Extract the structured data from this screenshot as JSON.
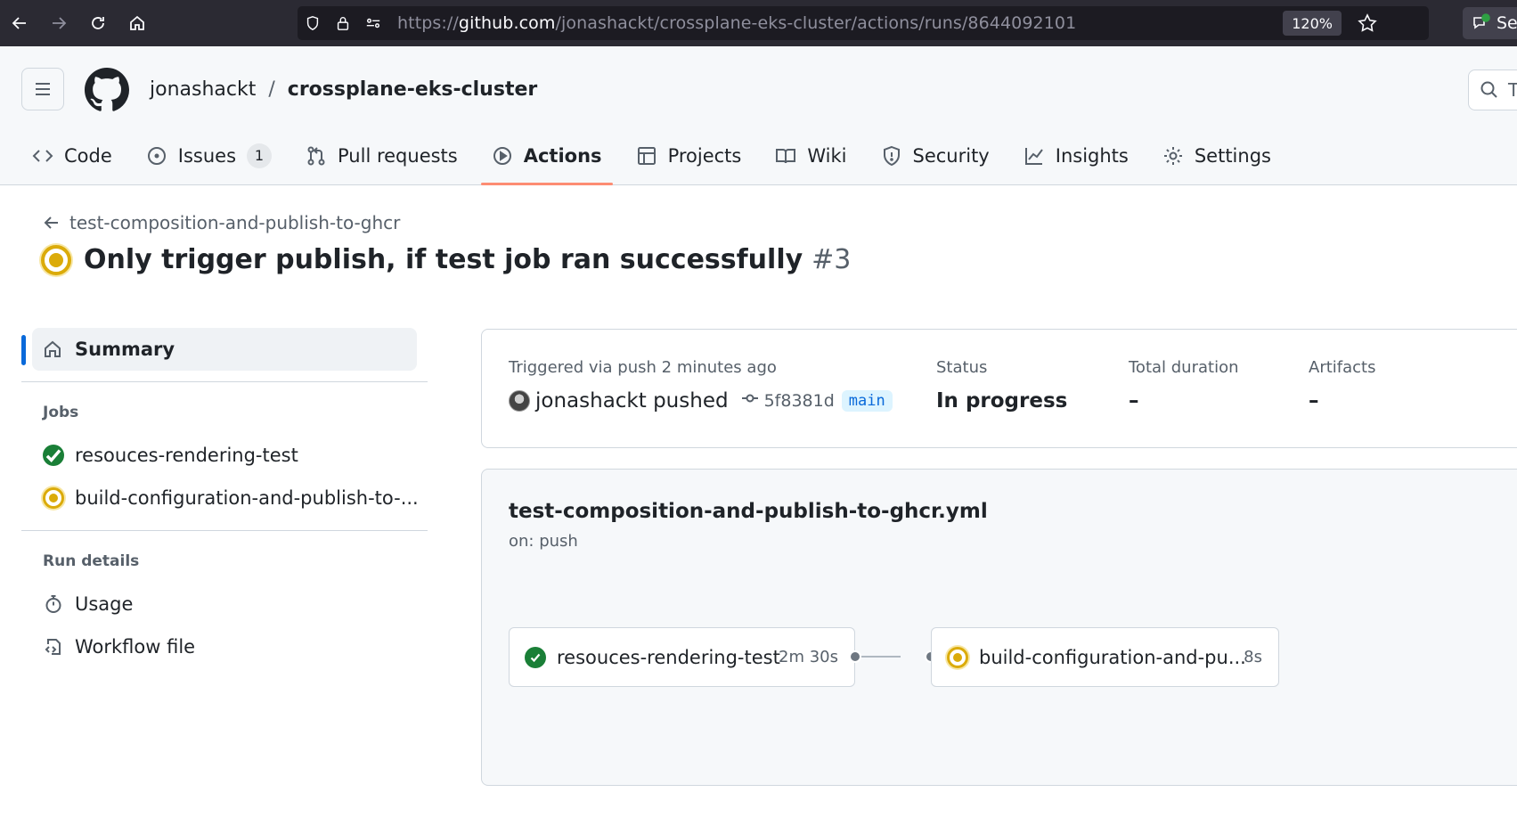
{
  "browser": {
    "url_prefix": "https://",
    "url_host": "github.com",
    "url_path": "/jonashackt/crossplane-eks-cluster/actions/runs/8644092101",
    "zoom": "120%",
    "extension_label": "Se"
  },
  "header": {
    "owner": "jonashackt",
    "separator": "/",
    "repo": "crossplane-eks-cluster",
    "search_placeholder": "T"
  },
  "tabs": [
    {
      "label": "Code"
    },
    {
      "label": "Issues",
      "count": "1"
    },
    {
      "label": "Pull requests"
    },
    {
      "label": "Actions"
    },
    {
      "label": "Projects"
    },
    {
      "label": "Wiki"
    },
    {
      "label": "Security"
    },
    {
      "label": "Insights"
    },
    {
      "label": "Settings"
    }
  ],
  "run": {
    "workflow_name": "test-composition-and-publish-to-ghcr",
    "title": "Only trigger publish, if test job ran successfully",
    "number": "#3"
  },
  "sidebar": {
    "summary_label": "Summary",
    "jobs_heading": "Jobs",
    "jobs": [
      {
        "label": "resouces-rendering-test",
        "status": "success"
      },
      {
        "label": "build-configuration-and-publish-to-...",
        "status": "in_progress"
      }
    ],
    "run_details_heading": "Run details",
    "usage_label": "Usage",
    "workflow_file_label": "Workflow file"
  },
  "summary": {
    "triggered_label": "Triggered via push 2 minutes ago",
    "actor": "jonashackt pushed",
    "sha": "5f8381d",
    "branch": "main",
    "status_label": "Status",
    "status_value": "In progress",
    "duration_label": "Total duration",
    "duration_value": "–",
    "artifacts_label": "Artifacts",
    "artifacts_value": "–"
  },
  "workflow": {
    "file": "test-composition-and-publish-to-ghcr.yml",
    "trigger": "on: push",
    "jobs": [
      {
        "name": "resouces-rendering-test",
        "duration": "2m 30s",
        "status": "success"
      },
      {
        "name": "build-configuration-and-pu...",
        "duration": "8s",
        "status": "in_progress"
      }
    ]
  },
  "colors": {
    "accent": "#0969da",
    "success": "#1a7f37",
    "in_progress": "#dbab0a",
    "tab_underline": "#fd8c73"
  }
}
